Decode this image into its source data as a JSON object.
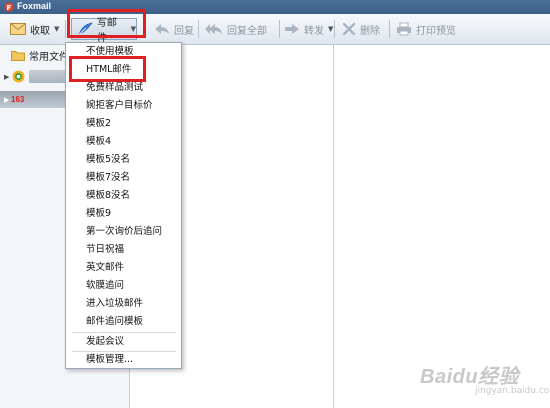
{
  "window": {
    "title": "Foxmail"
  },
  "toolbar": {
    "receive": "收取",
    "compose": "写邮件",
    "reply": "回复",
    "reply_all": "回复全部",
    "forward": "转发",
    "delete": "删除",
    "print_preview": "打印预览"
  },
  "sidebar": {
    "common_folder": "常用文件夹",
    "account2_label": "163"
  },
  "compose_menu": {
    "items": [
      "不使用模板",
      "HTML邮件",
      "免费样品测试",
      "婉拒客户目标价",
      "模板2",
      "模板4",
      "模板5没名",
      "模板7没名",
      "模板8没名",
      "模板9",
      "第一次询价后追问",
      "节日祝福",
      "英文邮件",
      "软膜追问",
      "进入垃圾邮件",
      "邮件追问模板"
    ],
    "start_meeting": "发起会议",
    "template_manage": "模板管理..."
  },
  "watermark": {
    "brand": "Baidu经验",
    "sub": "jingyan.baidu.com"
  },
  "colors": {
    "highlight": "#e02020",
    "titlebar": "#4a6f98"
  }
}
